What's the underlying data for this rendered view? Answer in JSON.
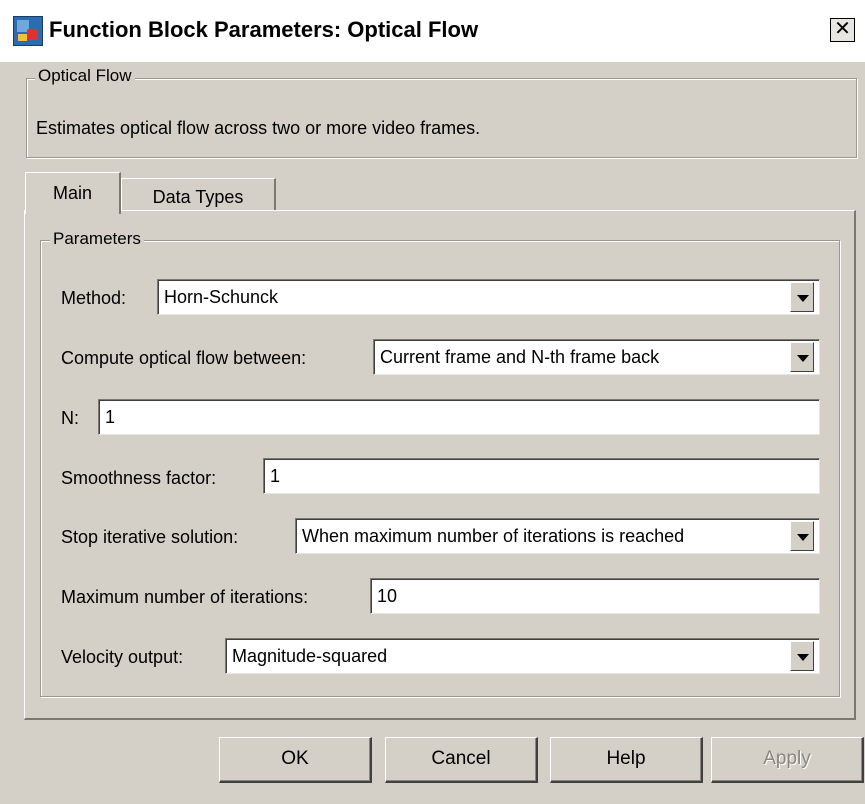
{
  "window": {
    "title": "Function Block Parameters: Optical Flow",
    "close_glyph": "✕"
  },
  "description_group": {
    "legend": "Optical Flow",
    "text": "Estimates optical flow across two or more video frames."
  },
  "tabs": [
    {
      "label": "Main",
      "active": true
    },
    {
      "label": "Data Types",
      "active": false
    }
  ],
  "parameters": {
    "legend": "Parameters",
    "method": {
      "label": "Method:",
      "value": "Horn-Schunck"
    },
    "compute_between": {
      "label": "Compute optical flow between:",
      "value": "Current frame and N-th frame back"
    },
    "n": {
      "label": "N:",
      "value": "1"
    },
    "smoothness": {
      "label": "Smoothness factor:",
      "value": "1"
    },
    "stop_solution": {
      "label": "Stop iterative solution:",
      "value": "When maximum number of iterations is reached"
    },
    "max_iterations": {
      "label": "Maximum number of iterations:",
      "value": "10"
    },
    "velocity_output": {
      "label": "Velocity output:",
      "value": "Magnitude-squared"
    }
  },
  "buttons": {
    "ok": "OK",
    "cancel": "Cancel",
    "help": "Help",
    "apply": "Apply",
    "apply_enabled": false
  },
  "icons": {
    "window_icon": "matlab-block-icon",
    "dropdown_icon": "triangle-down-icon"
  }
}
